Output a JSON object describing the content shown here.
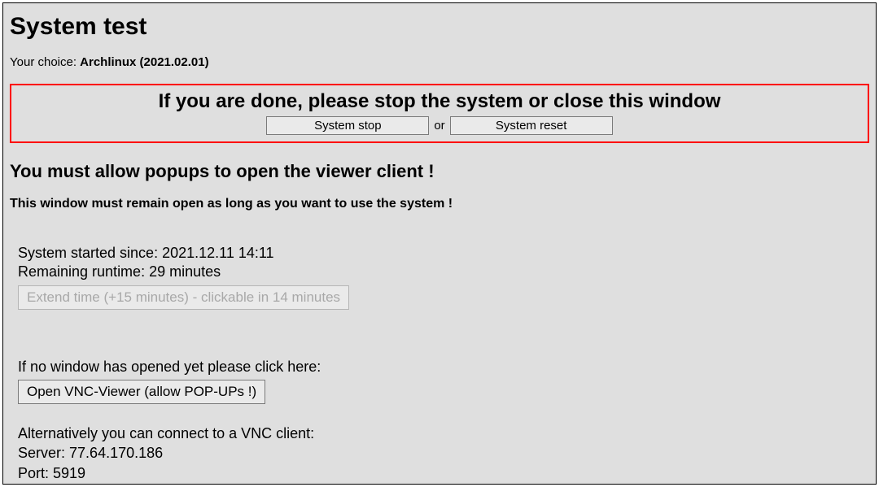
{
  "title": "System test",
  "choice": {
    "label": "Your choice: ",
    "value": "Archlinux (2021.02.01)"
  },
  "done_box": {
    "heading": "If you are done, please stop the system or close this window",
    "stop_label": "System stop",
    "or": "or",
    "reset_label": "System reset"
  },
  "popup_warning": "You must allow popups to open the viewer client !",
  "stay_open_warning": "This window must remain open as long as you want to use the system !",
  "status": {
    "started_label": "System started since: ",
    "started_value": "2021.12.11 14:11",
    "remaining_label": "Remaining runtime: ",
    "remaining_value": "29 minutes",
    "extend_label": "Extend time (+15 minutes) - clickable in 14 minutes"
  },
  "vnc": {
    "no_window_text": "If no window has opened yet please click here:",
    "open_viewer_label": "Open VNC-Viewer (allow POP-UPs !)",
    "alt_text": "Alternatively you can connect to a VNC client:",
    "server_label": "Server: ",
    "server_value": "77.64.170.186",
    "port_label": "Port: ",
    "port_value": "5919"
  }
}
